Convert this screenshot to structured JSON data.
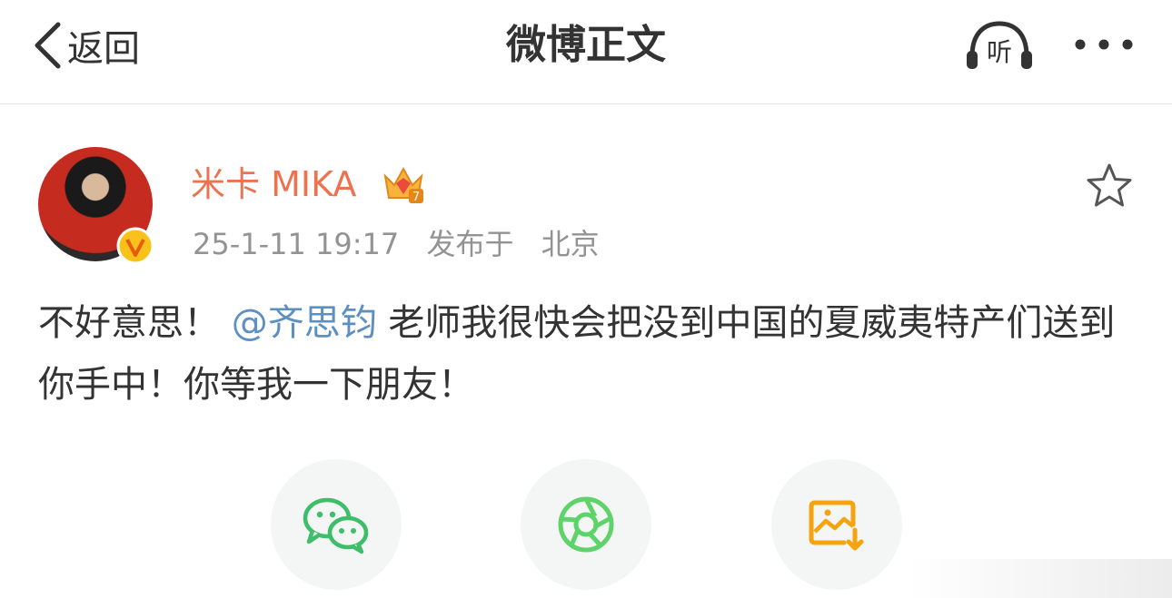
{
  "nav": {
    "back_label": "返回",
    "title": "微博正文",
    "listen_label": "听"
  },
  "post": {
    "author": "米卡 MIKA",
    "timestamp": "25-1-11 19:17",
    "published_in_label": "发布于",
    "location": "北京",
    "crown_level": "7",
    "content_before": "不好意思！",
    "mention": "@齐思钧",
    "content_after": " 老师我很快会把没到中国的夏威夷特产们送到你手中！你等我一下朋友！"
  },
  "share": {
    "items": [
      {
        "icon": "wechat-icon"
      },
      {
        "icon": "moments-icon"
      },
      {
        "icon": "save-image-icon"
      }
    ]
  },
  "colors": {
    "username": "#eb7350",
    "mention": "#5d8fc2",
    "wechat": "#3ebe6a",
    "moments": "#5ed36a",
    "save": "#f5a30e"
  }
}
